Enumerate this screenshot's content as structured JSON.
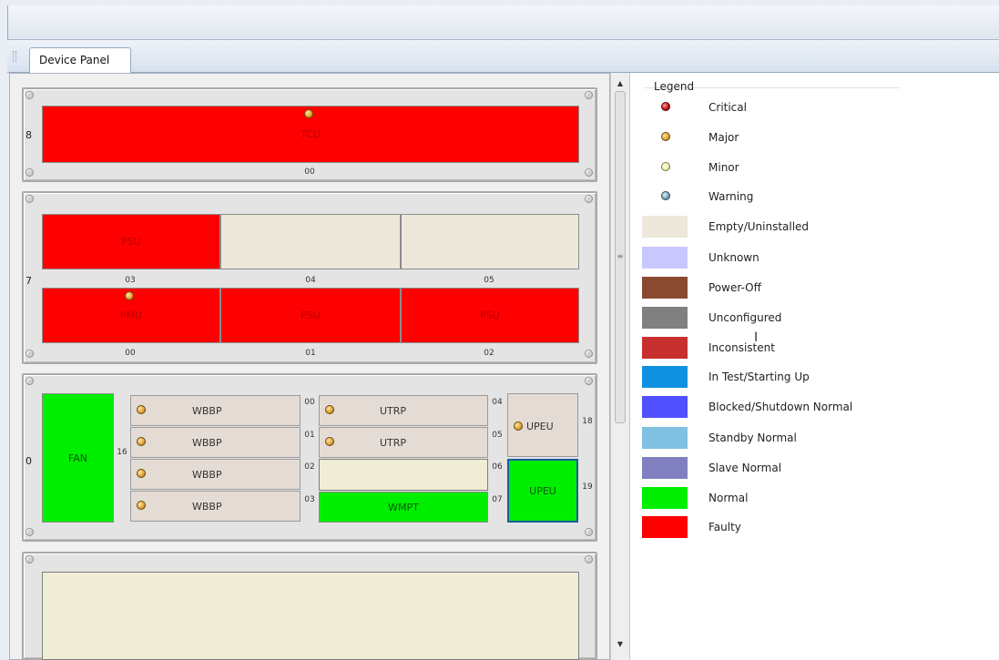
{
  "tabs": [
    {
      "label": "Device Panel",
      "active": true
    }
  ],
  "racks": {
    "rack8": {
      "row_number": "8",
      "slots": [
        {
          "slot": "00",
          "label": "TCU",
          "state": "Faulty",
          "alarm": "Major"
        }
      ]
    },
    "rack7": {
      "row_number": "7",
      "top_slots": [
        {
          "slot": "03",
          "label": "PSU",
          "state": "Faulty",
          "alarm": ""
        },
        {
          "slot": "04",
          "label": "",
          "state": "Empty/Uninstalled",
          "alarm": ""
        },
        {
          "slot": "05",
          "label": "",
          "state": "Empty/Uninstalled",
          "alarm": ""
        }
      ],
      "bottom_slots": [
        {
          "slot": "00",
          "label": "PMU",
          "state": "Faulty",
          "alarm": "Major"
        },
        {
          "slot": "01",
          "label": "PSU",
          "state": "Faulty",
          "alarm": ""
        },
        {
          "slot": "02",
          "label": "PSU",
          "state": "Faulty",
          "alarm": ""
        }
      ]
    },
    "rack0": {
      "row_number": "0",
      "fan": {
        "label": "FAN",
        "slot": "16",
        "state": "Normal"
      },
      "wbbp": [
        {
          "label": "WBBP",
          "slot": "00",
          "alarm": "Major"
        },
        {
          "label": "WBBP",
          "slot": "01",
          "alarm": "Major"
        },
        {
          "label": "WBBP",
          "slot": "02",
          "alarm": "Major"
        },
        {
          "label": "WBBP",
          "slot": "03",
          "alarm": "Major"
        }
      ],
      "middle": [
        {
          "label": "UTRP",
          "slot": "04",
          "alarm": "Major",
          "state": "Empty/Uninstalled"
        },
        {
          "label": "UTRP",
          "slot": "05",
          "alarm": "Major",
          "state": "Empty/Uninstalled"
        },
        {
          "label": "",
          "slot": "06",
          "alarm": "",
          "state": "Empty/Uninstalled"
        },
        {
          "label": "WMPT",
          "slot": "07",
          "alarm": "",
          "state": "Normal"
        }
      ],
      "upeu": [
        {
          "label": "UPEU",
          "slot": "18",
          "alarm": "Major",
          "state": "Empty/Uninstalled"
        },
        {
          "label": "UPEU",
          "slot": "19",
          "alarm": "",
          "state": "Normal",
          "selected": true
        }
      ]
    }
  },
  "legend": {
    "title": "Legend",
    "alarm_items": [
      {
        "label": "Critical",
        "icon": "critical-alarm-icon",
        "color": "#c01a1a"
      },
      {
        "label": "Major",
        "icon": "major-alarm-icon",
        "color": "#e3a43a"
      },
      {
        "label": "Minor",
        "icon": "minor-alarm-icon",
        "color": "#f0f0b0"
      },
      {
        "label": "Warning",
        "icon": "warning-alarm-icon",
        "color": "#7fa8b8"
      }
    ],
    "state_items": [
      {
        "label": "Empty/Uninstalled",
        "color": "#eee8db"
      },
      {
        "label": "Unknown",
        "color": "#c8c8ff"
      },
      {
        "label": "Power-Off",
        "color": "#8a4a30"
      },
      {
        "label": "Unconfigured",
        "color": "#808080"
      },
      {
        "label": "Inconsistent",
        "color": "#c83030"
      },
      {
        "label": "In Test/Starting Up",
        "color": "#1090e0"
      },
      {
        "label": "Blocked/Shutdown Normal",
        "color": "#5050ff"
      },
      {
        "label": "Standby Normal",
        "color": "#80c0e0"
      },
      {
        "label": "Slave Normal",
        "color": "#8080c0"
      },
      {
        "label": "Normal",
        "color": "#00ee00"
      },
      {
        "label": "Faulty",
        "color": "#ff0000"
      }
    ]
  }
}
